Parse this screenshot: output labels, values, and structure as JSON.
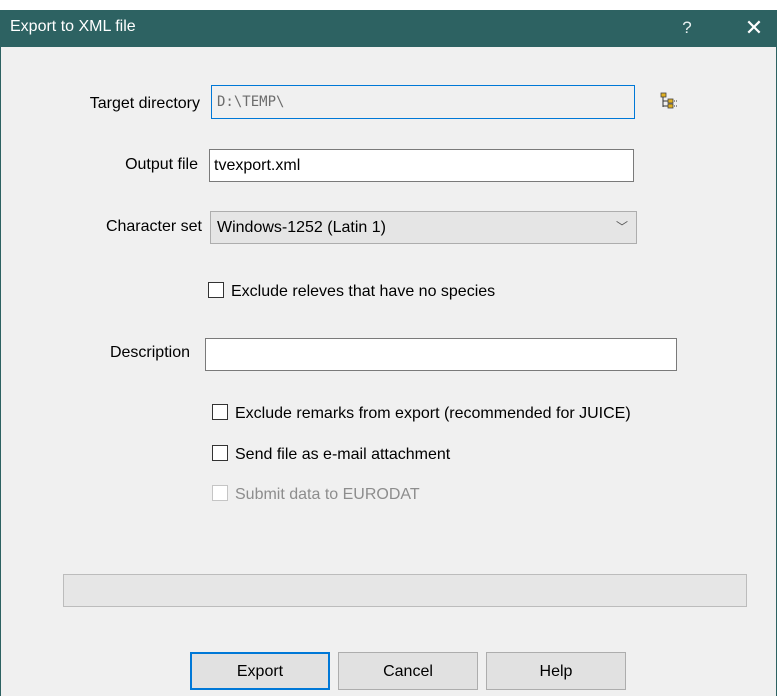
{
  "window": {
    "title": "Export to XML file",
    "help_glyph": "?",
    "close_glyph": "✕"
  },
  "form": {
    "target_directory": {
      "label": "Target directory",
      "value": "D:\\TEMP\\"
    },
    "browse_icon": "folder-tree-icon",
    "output_file": {
      "label": "Output file",
      "value": "tvexport.xml"
    },
    "character_set": {
      "label": "Character set",
      "selected": "Windows-1252 (Latin 1)"
    },
    "exclude_no_species": {
      "label": "Exclude releves that have no species",
      "checked": false
    },
    "description": {
      "label": "Description",
      "value": ""
    },
    "exclude_remarks": {
      "label": "Exclude remarks from export (recommended for JUICE)",
      "checked": false
    },
    "send_email": {
      "label": "Send file as e-mail attachment",
      "checked": false
    },
    "submit_eurodat": {
      "label": "Submit data to EURODAT",
      "checked": false,
      "disabled": true
    }
  },
  "progress": {
    "value": 0
  },
  "buttons": {
    "export": "Export",
    "cancel": "Cancel",
    "help": "Help"
  },
  "colors": {
    "titlebar": "#2d6262",
    "focus": "#0078d7"
  }
}
